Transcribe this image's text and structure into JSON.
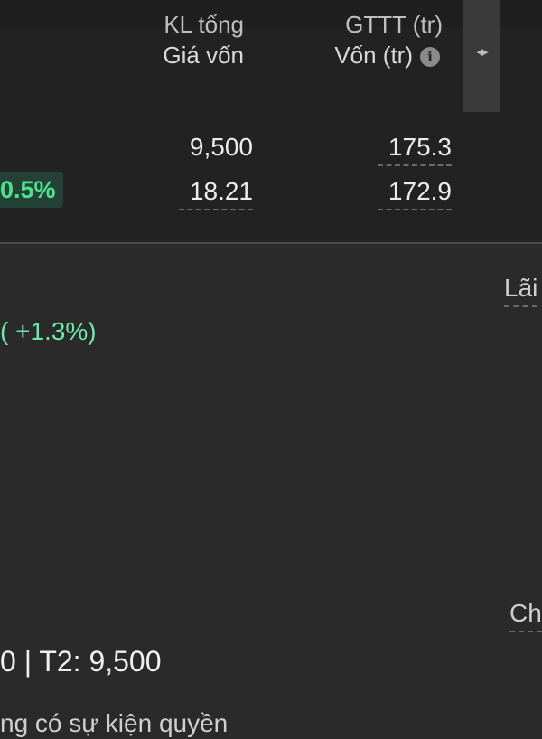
{
  "header": {
    "col1_line1": "KL tổng",
    "col1_line2": "Giá vốn",
    "col2_line1": "GTTT (tr)",
    "col2_line2": "Vốn (tr)",
    "info_icon": "i"
  },
  "scroll_handle_icon": "◂▸",
  "row": {
    "change_pct": "0.5%",
    "kl_tong": "9,500",
    "gia_von": "18.21",
    "gttt": "175.3",
    "von": "172.9"
  },
  "details": {
    "lai_label": "Lãi",
    "change_text": "( +1.3%)",
    "partial_paren": ")",
    "ch_label": "Ch",
    "t2_text": "0 | T2: 9,500",
    "bottom_text": "ng có sự kiện quyền"
  },
  "colors": {
    "background": "#2a2a2a",
    "panel": "#222222",
    "accent_green": "#4fe08e"
  }
}
